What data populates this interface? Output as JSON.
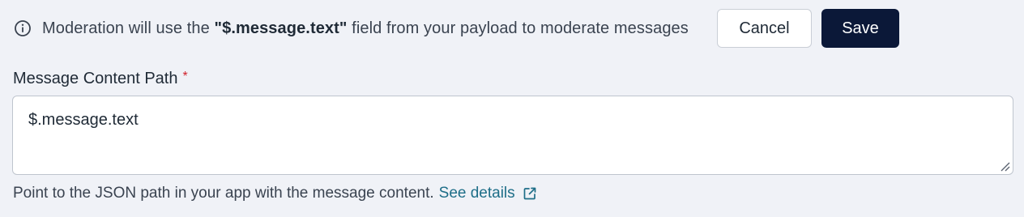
{
  "info": {
    "prefix": "Moderation will use the ",
    "field": "\"$.message.text\"",
    "suffix": " field from your payload to moderate messages",
    "icon": "info-circle-icon"
  },
  "actions": {
    "cancel_label": "Cancel",
    "save_label": "Save"
  },
  "field": {
    "label": "Message Content Path",
    "required_mark": "*",
    "value": "$.message.text",
    "help_text": "Point to the JSON path in your app with the message content.",
    "help_link_label": "See details",
    "help_link_icon": "external-link-icon"
  },
  "colors": {
    "background": "#f0f2f7",
    "primary_button": "#0b1838",
    "link": "#1e6e88",
    "required": "#d0202a"
  }
}
